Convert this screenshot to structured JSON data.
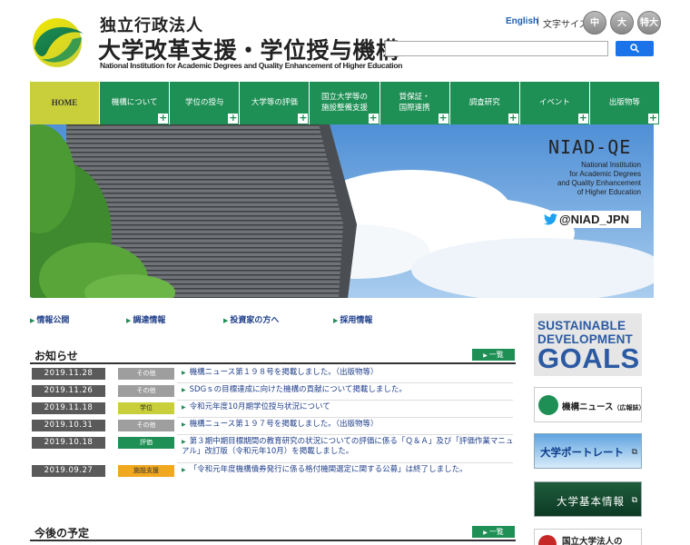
{
  "header": {
    "org_small": "独立行政法人",
    "org_big": "大学改革支援・学位授与機構",
    "org_en": "National Institution for Academic Degrees and Quality Enhancement of Higher Education",
    "lang_link": "English",
    "separator": "|",
    "font_size_label": "文字サイズ",
    "font_sizes": [
      "中",
      "大",
      "特大"
    ],
    "search_placeholder": ""
  },
  "nav": [
    {
      "label": "HOME",
      "plus": false
    },
    {
      "label": "機構について",
      "plus": true
    },
    {
      "label": "学位の授与",
      "plus": true
    },
    {
      "label": "大学等の評価",
      "plus": true
    },
    {
      "label": "国立大学等の\n施設整備支援",
      "plus": true
    },
    {
      "label": "質保証・\n国際連携",
      "plus": true
    },
    {
      "label": "調査研究",
      "plus": true
    },
    {
      "label": "イベント",
      "plus": true
    },
    {
      "label": "出版物等",
      "plus": true
    }
  ],
  "hero": {
    "title": "NIAD-QE",
    "subtitle": "National Institution\nfor Academic Degrees\nand Quality Enhancement\nof Higher Education",
    "twitter": "@NIAD_JPN"
  },
  "quick_links": [
    "情報公開",
    "調達情報",
    "投資家の方へ",
    "採用情報"
  ],
  "news": {
    "title": "お知らせ",
    "list_button": "一覧",
    "items": [
      {
        "date": "2019.11.28",
        "category": "その他",
        "cat_bg": "#9e9e9e",
        "cat_fg": "#fff",
        "text": "機構ニュース第１９８号を掲載しました。（出版物等）"
      },
      {
        "date": "2019.11.26",
        "category": "その他",
        "cat_bg": "#9e9e9e",
        "cat_fg": "#fff",
        "text": "SDGｓの目標達成に向けた機構の貢献について掲載しました。"
      },
      {
        "date": "2019.11.18",
        "category": "学位",
        "cat_bg": "#c8cf3a",
        "cat_fg": "#333",
        "text": "令和元年度10月期学位授与状況について"
      },
      {
        "date": "2019.10.31",
        "category": "その他",
        "cat_bg": "#9e9e9e",
        "cat_fg": "#fff",
        "text": "機構ニュース第１９７号を掲載しました。（出版物等）"
      },
      {
        "date": "2019.10.18",
        "category": "評価",
        "cat_bg": "#1e8f55",
        "cat_fg": "#fff",
        "text": "第３期中期目標期間の教育研究の状況についての評価に係る「Ｑ＆Ａ」及び「評価作業マニュアル」改訂版（令和元年10月）を掲載しました。"
      },
      {
        "date": "2019.09.27",
        "category": "施設支援",
        "cat_bg": "#f0a81e",
        "cat_fg": "#333",
        "text": "「令和元年度機構債券発行に係る格付機関選定に関する公募」は終了しました。"
      }
    ]
  },
  "schedule": {
    "title": "今後の予定",
    "list_button": "一覧"
  },
  "sidebar": {
    "sdg_line1": "SUSTAINABLE",
    "sdg_line2": "DEVELOPMENT",
    "sdg_line3": "GOALS",
    "news_banner": "機構ニュース",
    "news_banner_small": "（広報誌）",
    "portrait_banner": "大学ポートレート",
    "basic_info_banner": "大学基本情報",
    "national_univ_banner": "国立大学法人の"
  },
  "colors": {
    "nav_green": "#1e8f55",
    "home_yellow": "#c8cf3a",
    "link_blue": "#1f3f8a"
  }
}
